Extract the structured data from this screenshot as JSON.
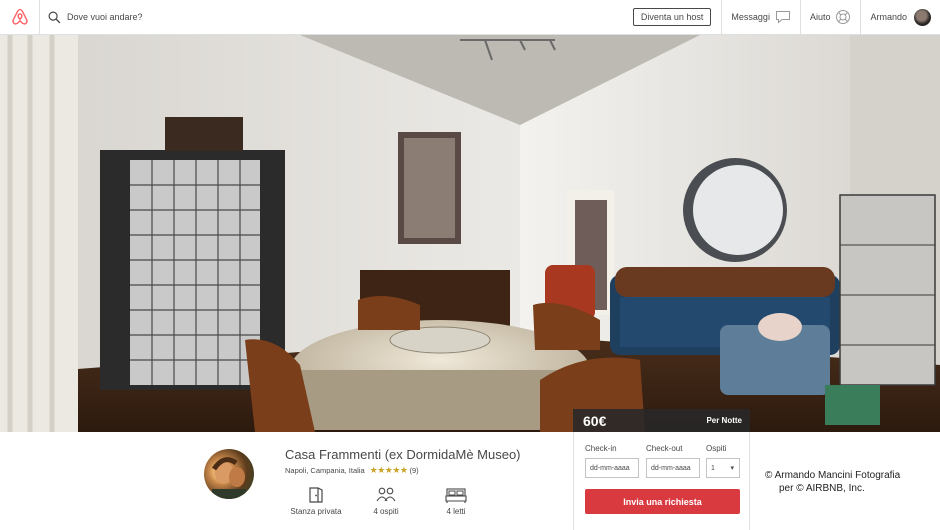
{
  "nav": {
    "search_placeholder": "Dove vuoi andare?",
    "become_host": "Diventa un host",
    "messages": "Messaggi",
    "help": "Aiuto",
    "user_name": "Armando"
  },
  "listing": {
    "price": "60€",
    "price_unit": "Per Notte",
    "title": "Casa Frammenti (ex DormidaMè Museo)",
    "location": "Napoli, Campania, Italia",
    "rating_stars": "★★★★★",
    "review_count": "(9)",
    "amenities": [
      {
        "label": "Stanza privata",
        "icon": "door-icon"
      },
      {
        "label": "4 ospiti",
        "icon": "guests-icon"
      },
      {
        "label": "4 letti",
        "icon": "bed-icon"
      }
    ]
  },
  "booking": {
    "checkin_label": "Check-in",
    "checkin_placeholder": "dd-mm-aaaa",
    "checkout_label": "Check-out",
    "checkout_placeholder": "dd-mm-aaaa",
    "guests_label": "Ospiti",
    "guests_value": "1",
    "request_button": "Invia una richiesta"
  },
  "credit": {
    "line1": "© Armando Mancini Fotografia",
    "line2": "per © AIRBNB, Inc."
  },
  "colors": {
    "brand": "#ff5a5f",
    "button": "#d93a40",
    "star": "#c9a227"
  }
}
